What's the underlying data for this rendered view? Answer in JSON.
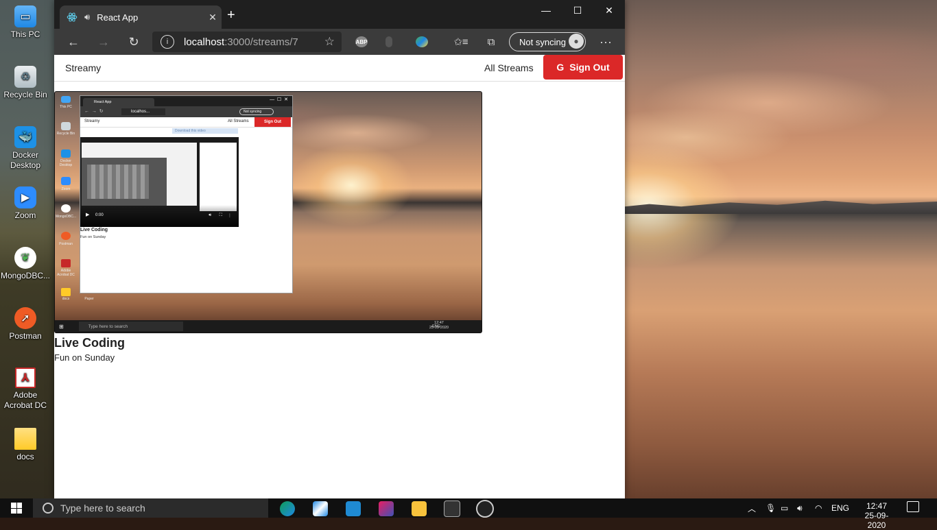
{
  "desktop": {
    "icons": [
      {
        "label": "This PC",
        "icon": "computer-icon"
      },
      {
        "label": "Recycle Bin",
        "icon": "recycle-bin-icon"
      },
      {
        "label": "Docker Desktop",
        "icon": "docker-icon"
      },
      {
        "label": "Zoom",
        "icon": "zoom-icon"
      },
      {
        "label": "MongoDBC...",
        "icon": "mongodb-icon"
      },
      {
        "label": "Postman",
        "icon": "postman-icon"
      },
      {
        "label": "Adobe Acrobat DC",
        "icon": "acrobat-icon"
      },
      {
        "label": "docs",
        "icon": "folder-icon"
      }
    ]
  },
  "browser": {
    "tab_title": "React App",
    "new_tab": "+",
    "url_host": "localhost",
    "url_path": ":3000/streams/7",
    "sync_label": "Not syncing",
    "more_label": "···"
  },
  "app": {
    "brand": "Streamy",
    "all_streams": "All Streams",
    "sign_out": "Sign Out",
    "stream": {
      "title": "Live Coding",
      "description": "Fun on Sunday"
    }
  },
  "video_preview": {
    "tab_title": "React App",
    "url": "localhos...",
    "sync_label": "Not syncing",
    "brand": "Streamy",
    "all_streams": "All Streams",
    "sign_out": "Sign Out",
    "download_banner": "Download this video",
    "play_time": "0:00",
    "stream_title": "Live Coding",
    "stream_description": "Fun on Sunday",
    "search_placeholder": "Type here to search",
    "lang": "ENG",
    "time": "12:47",
    "date": "25-09-2020",
    "desk_labels": [
      "This PC",
      "Recycle Bin",
      "Docker Desktop",
      "Zoom",
      "MongoDBC...",
      "Postman",
      "Adobe Acrobat DC",
      "docs",
      "Paper"
    ]
  },
  "taskbar": {
    "search_placeholder": "Type here to search",
    "lang": "ENG",
    "time": "12:47",
    "date": "25-09-2020"
  },
  "colors": {
    "accent_red": "#db2828",
    "taskbar": "#101010"
  }
}
